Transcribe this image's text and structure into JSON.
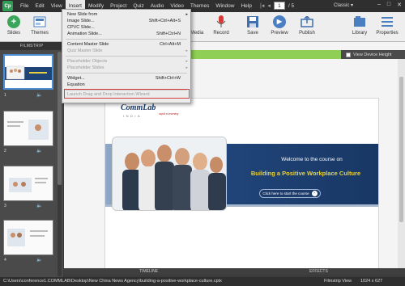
{
  "menubar": {
    "logo": "Cp",
    "items": [
      "File",
      "Edit",
      "View",
      "Insert",
      "Modify",
      "Project",
      "Quiz",
      "Audio",
      "Video",
      "Themes",
      "Window",
      "Help"
    ],
    "current_page": "1",
    "total_pages": "/ 5",
    "workspace": "Classic"
  },
  "toolbar": {
    "slides": "Slides",
    "themes": "Themes",
    "media": "Media",
    "record": "Record",
    "save": "Save",
    "preview": "Preview",
    "publish": "Publish",
    "library": "Library",
    "properties": "Properties"
  },
  "insert_menu": {
    "new_slide_from": "New Slide from",
    "image_slide": "Image Slide...",
    "image_slide_sc": "Shift+Ctrl+Alt+S",
    "cpvc_slide": "CPVC Slide...",
    "animation_slide": "Animation Slide...",
    "animation_slide_sc": "Shift+Ctrl+N",
    "content_master_slide": "Content Master Slide",
    "content_master_slide_sc": "Ctrl+Alt+M",
    "quiz_master_slide": "Quiz Master Slide",
    "placeholder_objects": "Placeholder Objects",
    "placeholder_slides": "Placeholder Slides",
    "widget": "Widget...",
    "widget_sc": "Shift+Ctrl+W",
    "equation": "Equation",
    "drag_drop_wizard": "Launch Drag and Drop Interaction Wizard"
  },
  "filmstrip": {
    "header": "FILMSTRIP",
    "slides": [
      "1",
      "2",
      "3",
      "4"
    ]
  },
  "stage": {
    "view_device_height": "View Device Height"
  },
  "slide": {
    "logo": "CommLab",
    "logo_sub": "INDIA",
    "logo_tag": "rapid eLearning",
    "welcome": "Welcome to the course on",
    "course_title": "Building a Positive Workplace Culture",
    "start_button": "Click here to start the course"
  },
  "bottom": {
    "timeline": "TIMELINE",
    "effects": "EFFECTS"
  },
  "status": {
    "path": "C:\\Users\\conference1.COMMLAB\\Desktop\\New China News Agency\\building-a-positive-workplace-culture.cptx",
    "view": "Filmstrip View",
    "size": "1024 x 627"
  }
}
